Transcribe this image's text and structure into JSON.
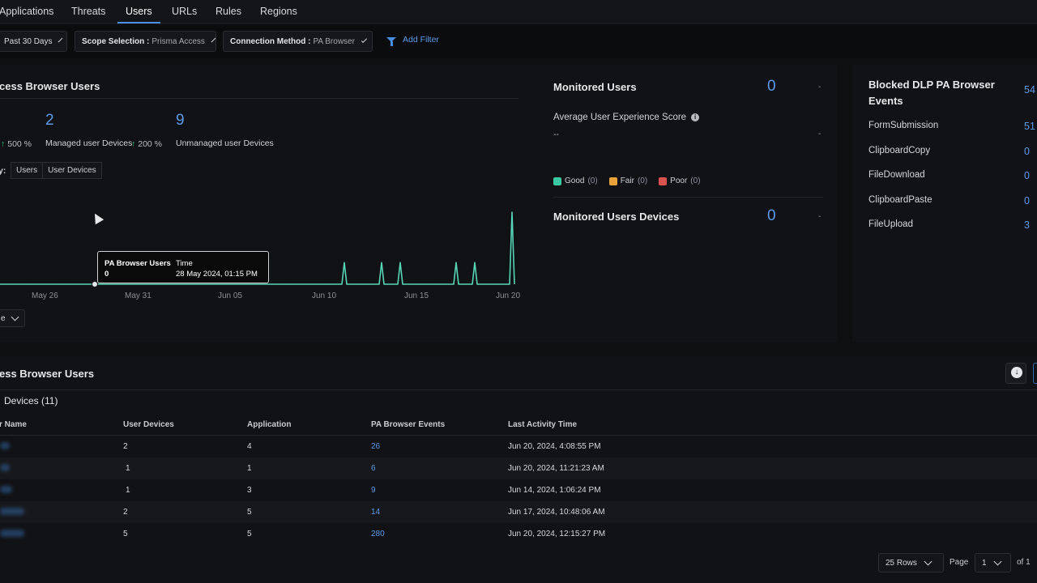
{
  "tabs": [
    {
      "label": "Applications",
      "active": false
    },
    {
      "label": "Threats",
      "active": false
    },
    {
      "label": "Users",
      "active": true
    },
    {
      "label": "URLs",
      "active": false
    },
    {
      "label": "Rules",
      "active": false
    },
    {
      "label": "Regions",
      "active": false
    }
  ],
  "filters": {
    "time": "Past 30 Days",
    "scope_label": "Scope Selection :",
    "scope_value": "Prisma Access",
    "conn_label": "Connection Method :",
    "conn_value": "PA Browser",
    "add_filter": "Add Filter"
  },
  "browser_users": {
    "title": "cess Browser Users",
    "users_change": "500 %",
    "managed_count": "2",
    "managed_label": "Managed user Devices",
    "managed_change": "200 %",
    "unmanaged_count": "9",
    "unmanaged_label": "Unmanaged user Devices",
    "toggle_prefix": "y:",
    "toggle_users": "Users",
    "toggle_devices": "User Devices",
    "dropdown_value": "e"
  },
  "chart_data": {
    "type": "line",
    "series": [
      {
        "name": "PA Browser Users"
      }
    ],
    "x_ticks": [
      "May 26",
      "May 31",
      "Jun 05",
      "Jun 10",
      "Jun 15",
      "Jun 20"
    ],
    "x": [
      "May 21",
      "May 23",
      "May 25",
      "May 27",
      "May 29",
      "May 31",
      "Jun 02",
      "Jun 04",
      "Jun 06",
      "Jun 08",
      "Jun 10",
      "Jun 11",
      "Jun 12",
      "Jun 13",
      "Jun 14",
      "Jun 15",
      "Jun 16",
      "Jun 17",
      "Jun 18",
      "Jun 19",
      "Jun 20"
    ],
    "values": [
      0,
      0,
      0,
      0,
      0,
      0,
      0,
      0,
      0,
      0,
      0,
      1,
      0,
      1,
      1,
      0,
      0,
      1,
      1,
      0,
      3
    ],
    "tooltip": {
      "series_label": "PA Browser Users",
      "series_value": "0",
      "time_label": "Time",
      "time_value": "28 May 2024, 01:15 PM"
    }
  },
  "monitored": {
    "users_title": "Monitored Users",
    "users_count": "0",
    "users_dash": "-",
    "ux_title": "Average User Experience Score",
    "ux_value": "--",
    "ux_dash": "-",
    "legend": [
      {
        "label": "Good",
        "count": "(0)",
        "color": "#3cc9a3"
      },
      {
        "label": "Fair",
        "count": "(0)",
        "color": "#e8a33b"
      },
      {
        "label": "Poor",
        "count": "(0)",
        "color": "#d9534f"
      }
    ],
    "devices_title": "Monitored Users Devices",
    "devices_count": "0",
    "devices_dash": "-"
  },
  "dlp": {
    "title_line1": "Blocked DLP PA Browser",
    "title_line2": "Events",
    "total": "54",
    "rows": [
      {
        "label": "FormSubmission",
        "value": "51"
      },
      {
        "label": "ClipboardCopy",
        "value": "0"
      },
      {
        "label": "FileDownload",
        "value": "0"
      },
      {
        "label": "ClipboardPaste",
        "value": "0"
      },
      {
        "label": "FileUpload",
        "value": "3"
      }
    ]
  },
  "table": {
    "title": "ess Browser Users",
    "subtab": "Devices (11)",
    "columns": [
      "r Name",
      "User Devices",
      "Application",
      "PA Browser Events",
      "Last Activity Time"
    ],
    "rows": [
      {
        "devices": "2",
        "apps": "4",
        "events": "26",
        "last": "Jun 20, 2024, 4:08:55 PM"
      },
      {
        "devices": "1",
        "apps": "1",
        "events": "6",
        "last": "Jun 20, 2024, 11:21:23 AM"
      },
      {
        "devices": "1",
        "apps": "3",
        "events": "9",
        "last": "Jun 14, 2024, 1:06:24 PM"
      },
      {
        "devices": "2",
        "apps": "5",
        "events": "14",
        "last": "Jun 17, 2024, 10:48:06 AM"
      },
      {
        "devices": "5",
        "apps": "5",
        "events": "280",
        "last": "Jun 20, 2024, 12:15:27 PM"
      }
    ],
    "rows_per_page": "25 Rows",
    "page_label": "Page",
    "page_value": "1",
    "page_of": "of 1"
  }
}
